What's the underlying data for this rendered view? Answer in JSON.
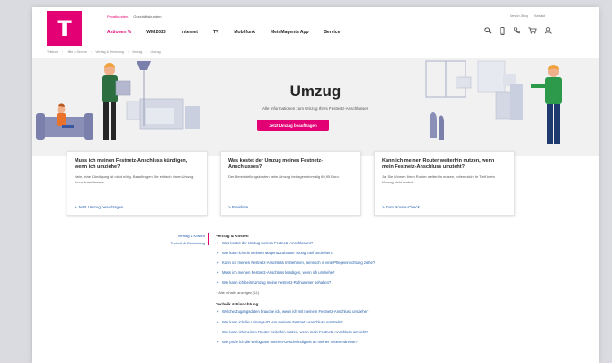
{
  "header": {
    "logo_letter": "T",
    "segments": [
      "Privatkunden",
      "Geschäftskunden"
    ],
    "top_links": [
      "Service-Shop",
      "Kontakt"
    ],
    "nav": [
      "Aktionen %",
      "WM 2026",
      "Internet",
      "TV",
      "Mobilfunk",
      "MeinMagenta App",
      "Service"
    ],
    "icons": [
      "search-icon",
      "mobile-icon",
      "phone-icon",
      "cart-icon",
      "user-icon"
    ]
  },
  "breadcrumb": [
    "Telekom",
    "Hilfe & Service",
    "Vertrag & Rechnung",
    "Vertrag",
    "Umzug"
  ],
  "hero": {
    "title": "Umzug",
    "subtitle": "Alle Informationen zum Umzug Ihres Festnetz-Anschlusses",
    "button": "Jetzt Umzug beauftragen"
  },
  "cards": [
    {
      "title": "Muss ich meinen Festnetz-Anschluss kündigen, wenn ich umziehe?",
      "text": "Nein, eine Kündigung ist nicht nötig. Beauftragen Sie einfach einen Umzug Ihres Anschlusses.",
      "link": "Jetzt Umzug beauftragen"
    },
    {
      "title": "Was kostet der Umzug meines Festnetz-Anschlusses?",
      "text": "Der Bereitstellungskosten beim Umzug betragen einmalig 69,95 Euro.",
      "link": "Preisliste"
    },
    {
      "title": "Kann ich meinen Router weiterhin nutzen, wenn mein Festnetz-Anschluss umzieht?",
      "text": "Ja, Sie können Ihren Router weiterhin nutzen, sofern sich Ihr Tarif beim Umzug nicht ändert.",
      "link": "Zum Router-Check"
    }
  ],
  "sidenav": [
    "Vertrag & Kosten",
    "Technik & Einrichtung"
  ],
  "faq": {
    "section1": "Vertrag & Kosten",
    "items1": [
      "Was kostet der Umzug meines Festnetz-Anschlusses?",
      "Wie kann ich mit meinem MagentaZuhause Young Tarif umziehen?",
      "Kann ich meinen Festnetz-Anschluss mitnehmen, wenn ich in eine Pflegeeinrichtung ziehe?",
      "Muss ich meinen Festnetz-Anschluss kündigen, wenn ich umziehe?",
      "Wie kann ich beim Umzug meine Festnetz-Rufnummer behalten?"
    ],
    "more": "+ Alle Inhalte anzeigen (11)",
    "section2": "Technik & Einrichtung",
    "items2": [
      "Welche Zugangsdaten brauche ich, wenn ich mit meinem Festnetz-Anschluss umziehe?",
      "Wie kann ich die Leitungs-ID von meinem Festnetz-Anschluss ermitteln?",
      "Wie kann ich meinen Router weiterhin nutzen, wenn mein Festnetz-Anschluss umzieht?",
      "Wie prüfe ich die verfügbare Internet-Geschwindigkeit an meiner neuen Adresse?"
    ]
  },
  "colors": {
    "brand": "#e20074",
    "link": "#1e5aa8",
    "hero_bg": "#f1f1f1"
  }
}
